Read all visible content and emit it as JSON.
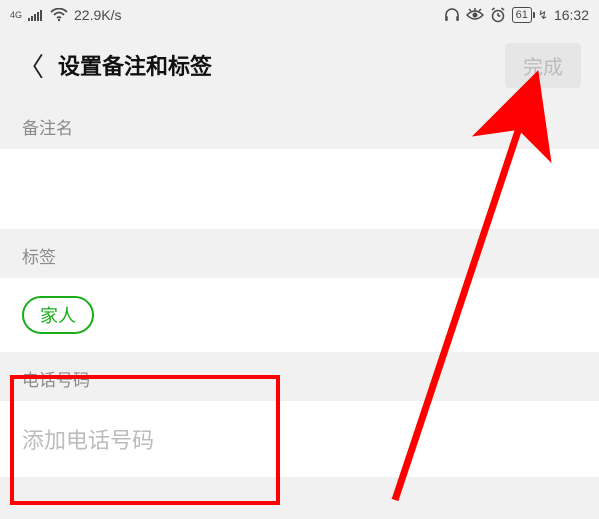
{
  "status": {
    "net_label": "4G",
    "speed": "22.9K/s",
    "battery_level": "61",
    "charging_glyph": "↯",
    "time": "16:32"
  },
  "header": {
    "title": "设置备注和标签",
    "done_label": "完成"
  },
  "sections": {
    "remark_label": "备注名",
    "tags_label": "标签",
    "tag_value": "家人",
    "phone_label": "电话号码",
    "phone_placeholder": "添加电话号码"
  }
}
